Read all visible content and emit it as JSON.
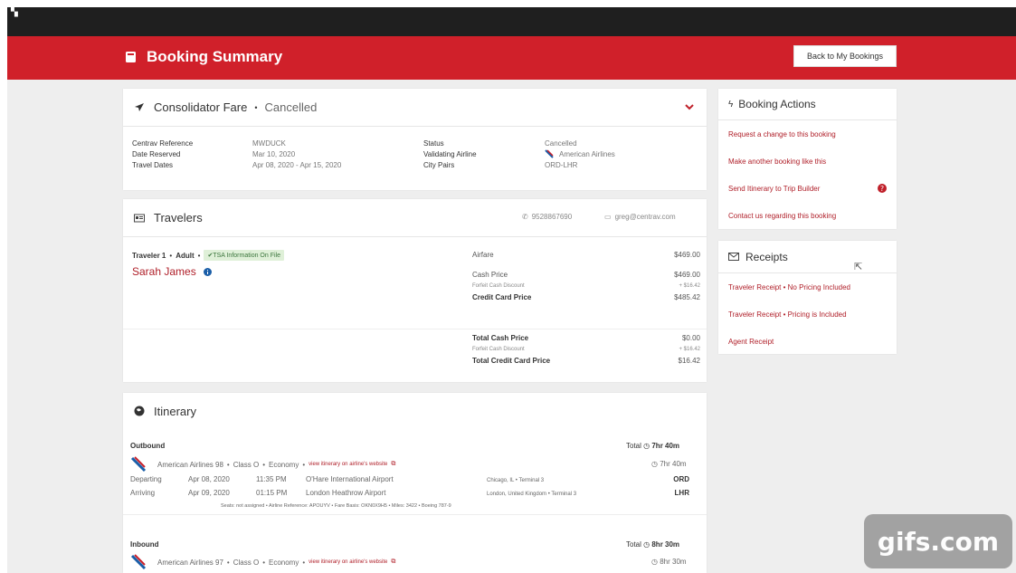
{
  "header": {
    "title": "Booking Summary",
    "back_button": "Back to My Bookings"
  },
  "consolidator": {
    "title": "Consolidator Fare",
    "sep": "•",
    "status": "Cancelled",
    "fields_left": [
      {
        "label": "Centrav Reference",
        "value": "MWDUCK"
      },
      {
        "label": "Date Reserved",
        "value": "Mar 10, 2020"
      },
      {
        "label": "Travel Dates",
        "value": "Apr 08, 2020 - Apr 15, 2020"
      }
    ],
    "fields_right": [
      {
        "label": "Status",
        "value": "Cancelled"
      },
      {
        "label": "Validating Airline",
        "value": "American Airlines"
      },
      {
        "label": "City Pairs",
        "value": "ORD-LHR"
      }
    ]
  },
  "travelers": {
    "title": "Travelers",
    "phone": "9528867690",
    "email": "greg@centrav.com",
    "traveler_label": "Traveler 1",
    "traveler_type": "Adult",
    "tsa_badge": "✔TSA Information On File",
    "name": "Sarah James",
    "pricing": [
      {
        "label": "Airfare",
        "value": "$469.00"
      },
      {
        "label": "Cash Price",
        "value": "$469.00"
      },
      {
        "label": "Forfeit Cash Discount",
        "value": "+ $16.42"
      },
      {
        "label": "Credit Card Price",
        "value": "$485.42"
      }
    ],
    "totals": [
      {
        "label": "Total Cash Price",
        "value": "$0.00"
      },
      {
        "label": "Forfeit Cash Discount",
        "value": "+ $16.42"
      },
      {
        "label": "Total Credit Card Price",
        "value": "$16.42"
      }
    ]
  },
  "itinerary": {
    "title": "Itinerary",
    "outbound": {
      "label": "Outbound",
      "total": "Total",
      "total_time": "7hr 40m",
      "airline": "American Airlines 98",
      "class": "Class O",
      "cabin": "Economy",
      "link": "view itinerary on airline's website",
      "duration": "7hr 40m",
      "departing": {
        "label": "Departing",
        "date": "Apr 08, 2020",
        "time": "11:35 PM",
        "airport": "O'Hare International Airport",
        "city": "Chicago, IL • Terminal 3",
        "code": "ORD"
      },
      "arriving": {
        "label": "Arriving",
        "date": "Apr 09, 2020",
        "time": "01:15 PM",
        "airport": "London Heathrow Airport",
        "city": "London, United Kingdom • Terminal 3",
        "code": "LHR"
      },
      "details": "Seats: not assigned  •  Airline Reference: APOUYV  •  Fare Basis: OKN0X9H5  •  Miles: 3422  •  Boeing 787-9"
    },
    "inbound": {
      "label": "Inbound",
      "total": "Total",
      "total_time": "8hr 30m",
      "airline": "American Airlines 97",
      "class": "Class O",
      "cabin": "Economy",
      "link": "view itinerary on airline's website",
      "duration": "8hr 30m"
    }
  },
  "booking_actions": {
    "title": "Booking Actions",
    "items": [
      "Request a change to this booking",
      "Make another booking like this",
      "Send Itinerary to Trip Builder",
      "Contact us regarding this booking"
    ]
  },
  "receipts": {
    "title": "Receipts",
    "items": [
      "Traveler Receipt  •  No Pricing Included",
      "Traveler Receipt  •  Pricing is Included",
      "Agent Receipt"
    ]
  },
  "watermark": "gifs.com",
  "colors": {
    "brand_red": "#d0202a",
    "link_red": "#b0202a",
    "tsa_green": "#dff0d8"
  }
}
